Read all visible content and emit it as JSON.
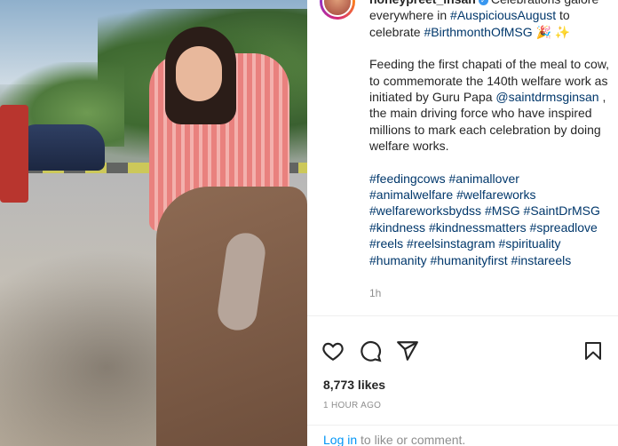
{
  "post": {
    "username": "honeypreet_insan",
    "caption_line1": "Celebrations galore everywhere in ",
    "hashtag_month": "#AuspiciousAugust",
    "caption_to": " to celebrate ",
    "hashtag_birth": "#BirthmonthOfMSG",
    "caption_emoji": " 🎉 ✨",
    "para2_a": "Feeding the first chapati of the meal to cow, to commemorate the 140th welfare work as initiated by Guru Papa ",
    "mention": "@saintdrmsginsan",
    "para2_b": " , the main driving force who have inspired millions to mark each celebration by doing welfare works.",
    "hashtags": [
      "#feedingcows",
      "#animallover",
      "#animalwelfare",
      "#welfareworks",
      "#welfareworksbydss",
      "#MSG",
      "#SaintDrMSG",
      "#kindness",
      "#kindnessmatters",
      "#spreadlove",
      "#reels",
      "#reelsinstagram",
      "#spirituality",
      "#humanity",
      "#humanityfirst",
      "#instareels"
    ],
    "time_ago": "1h",
    "likes": "8,773 likes",
    "posted": "1 HOUR AGO",
    "login_link": "Log in",
    "login_rest": " to like or comment."
  },
  "icons": {
    "like": "heart-icon",
    "comment": "comment-icon",
    "share": "send-icon",
    "save": "bookmark-icon"
  },
  "colors": {
    "link": "#00376b",
    "login": "#0095f6",
    "muted": "#8e8e8e"
  }
}
